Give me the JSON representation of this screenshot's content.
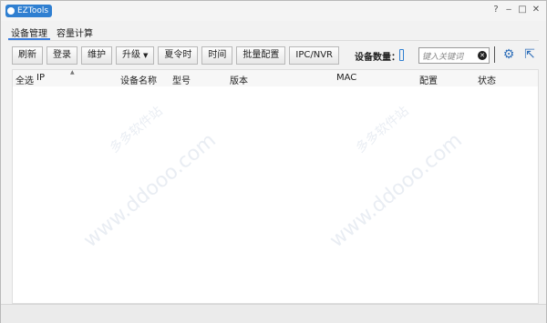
{
  "titlebar": {
    "app_name": "EZTools",
    "help_icon": "?",
    "minimize_icon": "‒",
    "maximize_icon": "□",
    "close_icon": "✕"
  },
  "tabs": [
    {
      "label": "设备管理"
    },
    {
      "label": "容量计算"
    }
  ],
  "toolbar": {
    "refresh": "刷新",
    "login": "登录",
    "maintain": "维护",
    "upgrade": "升级",
    "dst": "夏令时",
    "time": "时间",
    "batch_config": "批量配置",
    "ipc_nvr": "IPC/NVR"
  },
  "device_count": {
    "label": "设备数量：",
    "value": ""
  },
  "search": {
    "placeholder": "键入关键词"
  },
  "table": {
    "columns": [
      "全选",
      "IP",
      "设备名称",
      "型号",
      "版本",
      "MAC",
      "配置",
      "状态"
    ],
    "rows": []
  },
  "watermark": {
    "text": "www.ddooo.com",
    "text2": "多多软件站"
  }
}
